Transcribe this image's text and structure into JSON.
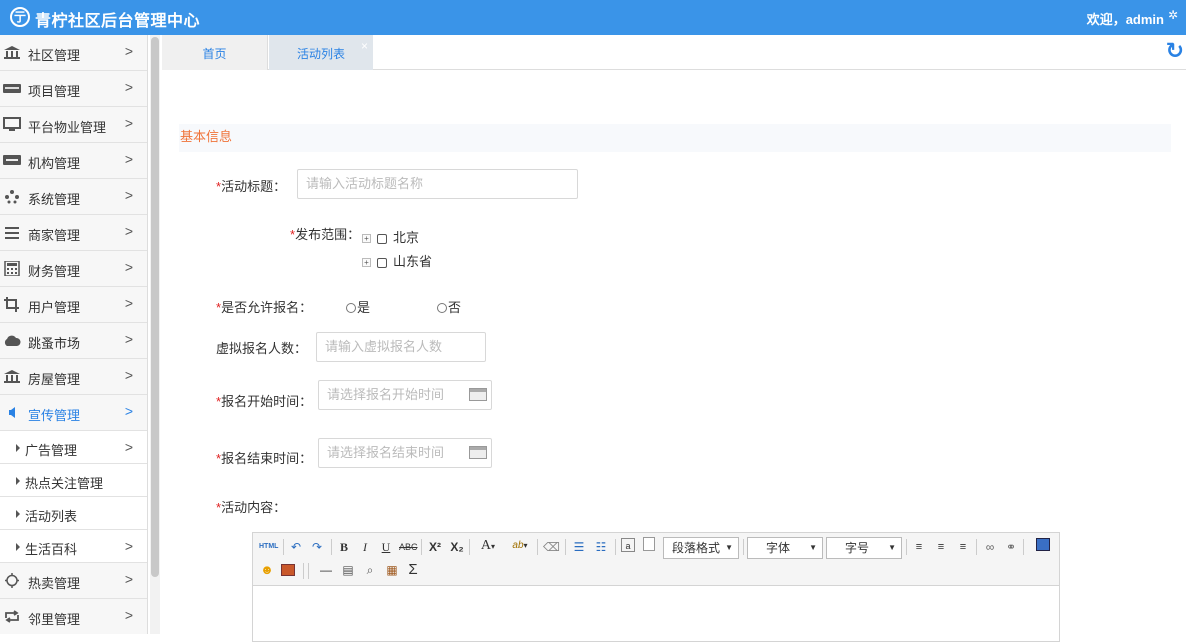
{
  "header": {
    "logo_glyph": "亍",
    "title": "青柠社区后台管理中心",
    "welcome": "欢迎，admin",
    "settings_glyph": "✲"
  },
  "sidebar": {
    "items": [
      {
        "label": "社区管理",
        "icon": "bank-icon"
      },
      {
        "label": "项目管理",
        "icon": "discover-card-icon"
      },
      {
        "label": "平台物业管理",
        "icon": "monitor-icon"
      },
      {
        "label": "机构管理",
        "icon": "stripe-icon"
      },
      {
        "label": "系统管理",
        "icon": "yelp-icon"
      },
      {
        "label": "商家管理",
        "icon": "bars-icon"
      },
      {
        "label": "财务管理",
        "icon": "calculator-icon"
      },
      {
        "label": "用户管理",
        "icon": "crop-icon"
      },
      {
        "label": "跳蚤市场",
        "icon": "cloud-icon"
      },
      {
        "label": "房屋管理",
        "icon": "bank-icon"
      },
      {
        "label": "宣传管理",
        "icon": "volume-icon",
        "active": true
      },
      {
        "label": "广告管理",
        "sub": true
      },
      {
        "label": "热点关注管理",
        "sub": true
      },
      {
        "label": "活动列表",
        "sub": true
      },
      {
        "label": "生活百科",
        "sub": true
      },
      {
        "label": "热卖管理",
        "icon": "sun-icon"
      },
      {
        "label": "邻里管理",
        "icon": "retweet-icon"
      }
    ],
    "chevron": ">"
  },
  "tabs": {
    "home": "首页",
    "active": "活动列表",
    "close": "×",
    "refresh_glyph": "↻"
  },
  "form": {
    "section_title": "基本信息",
    "required_mark": "*",
    "title_label": "活动标题：",
    "title_placeholder": "请输入活动标题名称",
    "scope_label": "发布范围：",
    "scope_nodes": [
      "北京",
      "山东省"
    ],
    "allow_signup_label": "是否允许报名：",
    "yes": "是",
    "no": "否",
    "virtual_count_label": "虚拟报名人数：",
    "virtual_count_placeholder": "请输入虚拟报名人数",
    "start_label": "报名开始时间：",
    "start_placeholder": "请选择报名开始时间",
    "end_label": "报名结束时间：",
    "end_placeholder": "请选择报名结束时间",
    "content_label": "活动内容："
  },
  "editor": {
    "html_btn": "HTML",
    "bold": "B",
    "italic": "I",
    "underline": "U",
    "strike": "ABC",
    "sup": "X²",
    "sub": "X₂",
    "font_color": "A",
    "highlight": "ab",
    "paragraph_select": "段落格式",
    "font_select": "字体",
    "size_select": "字号",
    "sigma": "Σ"
  }
}
